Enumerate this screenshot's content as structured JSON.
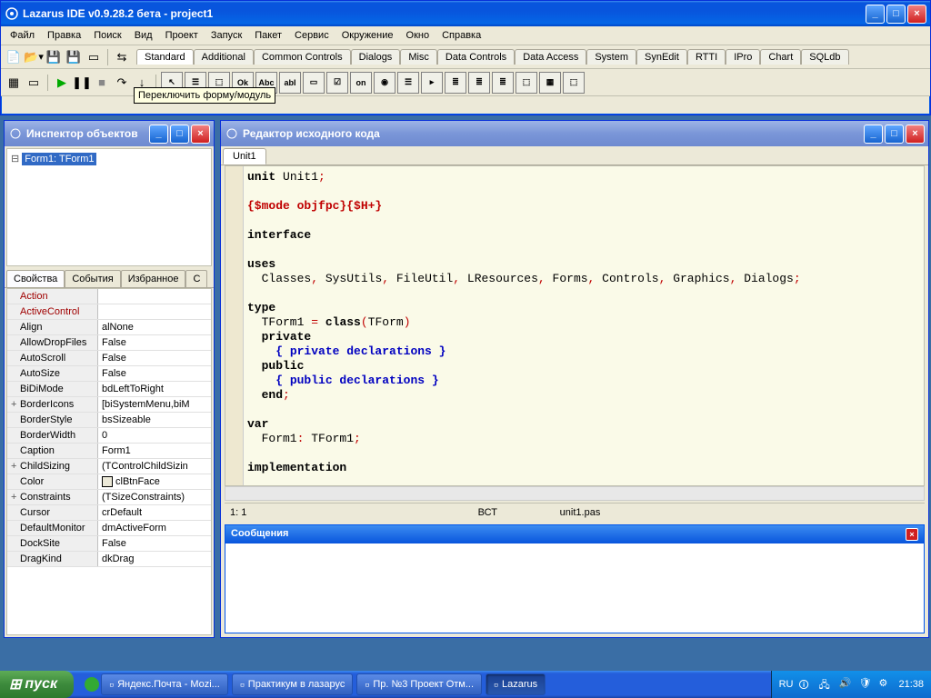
{
  "ide": {
    "title": "Lazarus IDE v0.9.28.2 бета - project1",
    "menu": [
      "Файл",
      "Правка",
      "Поиск",
      "Вид",
      "Проект",
      "Запуск",
      "Пакет",
      "Сервис",
      "Окружение",
      "Окно",
      "Справка"
    ],
    "palette_tabs": [
      "Standard",
      "Additional",
      "Common Controls",
      "Dialogs",
      "Misc",
      "Data Controls",
      "Data Access",
      "System",
      "SynEdit",
      "RTTI",
      "IPro",
      "Chart",
      "SQLdb"
    ],
    "active_palette": "Standard",
    "tooltip": "Переключить форму/модуль",
    "components": [
      "↖",
      "☰",
      "⬚",
      "Ok",
      "Abc",
      "abI",
      "▭",
      "☑",
      "on",
      "◉",
      "☰",
      "▸",
      "≣",
      "≣",
      "≣",
      "⬚",
      "▦",
      "⬚"
    ]
  },
  "inspector": {
    "title": "Инспектор объектов",
    "tree_item": "Form1: TForm1",
    "tabs": [
      "Свойства",
      "События",
      "Избранное",
      "С"
    ],
    "active_tab": "Свойства",
    "props": [
      {
        "name": "Action",
        "val": "",
        "red": true
      },
      {
        "name": "ActiveControl",
        "val": "",
        "red": true
      },
      {
        "name": "Align",
        "val": "alNone"
      },
      {
        "name": "AllowDropFiles",
        "val": "False"
      },
      {
        "name": "AutoScroll",
        "val": "False"
      },
      {
        "name": "AutoSize",
        "val": "False"
      },
      {
        "name": "BiDiMode",
        "val": "bdLeftToRight"
      },
      {
        "name": "BorderIcons",
        "val": "[biSystemMenu,biM",
        "exp": "+"
      },
      {
        "name": "BorderStyle",
        "val": "bsSizeable"
      },
      {
        "name": "BorderWidth",
        "val": "0"
      },
      {
        "name": "Caption",
        "val": "Form1"
      },
      {
        "name": "ChildSizing",
        "val": "(TControlChildSizin",
        "exp": "+"
      },
      {
        "name": "Color",
        "val": "clBtnFace",
        "swatch": true
      },
      {
        "name": "Constraints",
        "val": "(TSizeConstraints)",
        "exp": "+"
      },
      {
        "name": "Cursor",
        "val": "crDefault"
      },
      {
        "name": "DefaultMonitor",
        "val": "dmActiveForm"
      },
      {
        "name": "DockSite",
        "val": "False"
      },
      {
        "name": "DragKind",
        "val": "dkDrag"
      }
    ]
  },
  "editor": {
    "title": "Редактор исходного кода",
    "file_tab": "Unit1",
    "status": {
      "pos": "1: 1",
      "mode": "ВСТ",
      "file": "unit1.pas"
    },
    "messages_title": "Сообщения"
  },
  "taskbar": {
    "start": "пуск",
    "items": [
      {
        "label": "Яндекс.Почта - Mozi..."
      },
      {
        "label": "Практикум в лазарус"
      },
      {
        "label": "Пр. №3 Проект Отм..."
      },
      {
        "label": "Lazarus",
        "active": true
      }
    ],
    "lang": "RU",
    "time": "21:38"
  }
}
